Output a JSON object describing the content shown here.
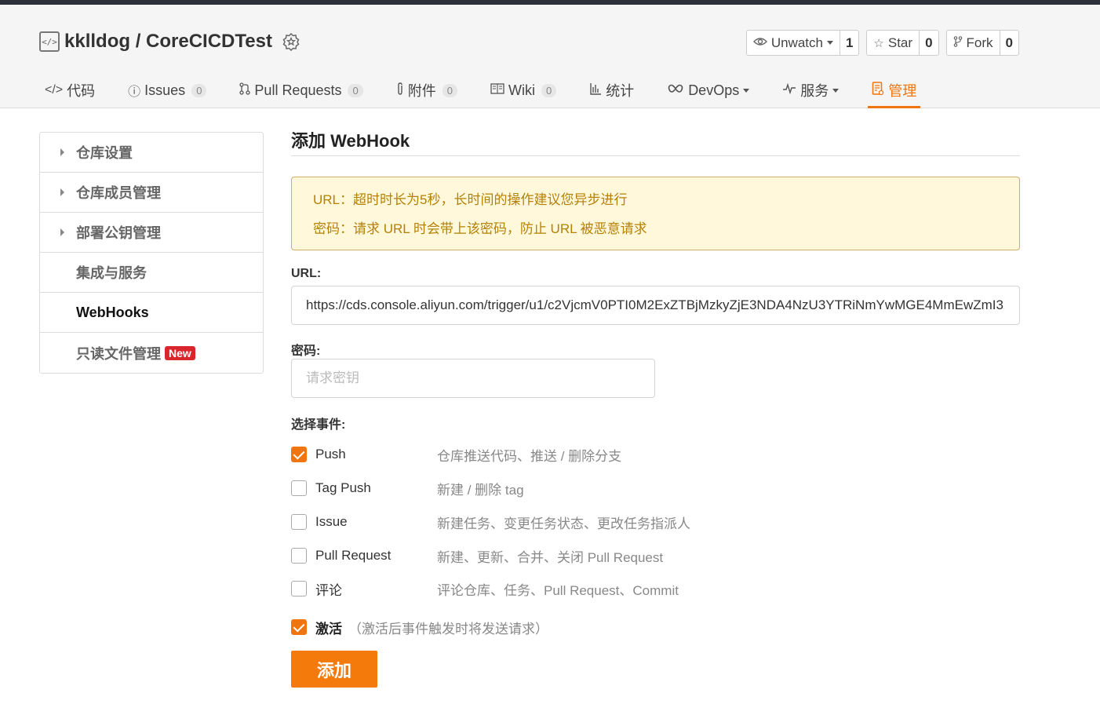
{
  "repo": {
    "owner": "kklldog",
    "separator": "/",
    "name": "CoreCICDTest"
  },
  "actions": {
    "watch": {
      "label": "Unwatch",
      "count": "1"
    },
    "star": {
      "label": "Star",
      "count": "0"
    },
    "fork": {
      "label": "Fork",
      "count": "0"
    }
  },
  "tabs": [
    {
      "label": "代码",
      "icon": "code-icon"
    },
    {
      "label": "Issues",
      "count": "0",
      "icon": "issue-icon"
    },
    {
      "label": "Pull Requests",
      "count": "0",
      "icon": "pull-request-icon"
    },
    {
      "label": "附件",
      "count": "0",
      "icon": "paperclip-icon"
    },
    {
      "label": "Wiki",
      "count": "0",
      "icon": "book-icon"
    },
    {
      "label": "统计",
      "icon": "bar-chart-icon"
    },
    {
      "label": "DevOps",
      "icon": "infinity-icon"
    },
    {
      "label": "服务",
      "icon": "pulse-icon"
    },
    {
      "label": "管理",
      "icon": "settings-doc-icon"
    }
  ],
  "sidebar": {
    "items": [
      {
        "label": "仓库设置"
      },
      {
        "label": "仓库成员管理"
      },
      {
        "label": "部署公钥管理"
      },
      {
        "label": "集成与服务"
      },
      {
        "label": "WebHooks"
      },
      {
        "label": "只读文件管理",
        "badge": "New"
      }
    ]
  },
  "main": {
    "title": "添加 WebHook",
    "notice": {
      "line1": "URL：超时时长为5秒，长时间的操作建议您异步进行",
      "line2": "密码：请求 URL 时会带上该密码，防止 URL 被恶意请求"
    },
    "url_label": "URL:",
    "url_value": "https://cds.console.aliyun.com/trigger/u1/c2VjcmV0PTI0M2ExZTBjMzkyZjE3NDA4NzU3YTRiNmYwMGE4MmEwZmI3",
    "password_label": "密码:",
    "password_placeholder": "请求密钥",
    "events_label": "选择事件:",
    "events": [
      {
        "name": "Push",
        "desc": "仓库推送代码、推送 / 删除分支",
        "checked": true
      },
      {
        "name": "Tag Push",
        "desc": "新建 / 删除 tag",
        "checked": false
      },
      {
        "name": "Issue",
        "desc": "新建任务、变更任务状态、更改任务指派人",
        "checked": false
      },
      {
        "name": "Pull Request",
        "desc": "新建、更新、合并、关闭 Pull Request",
        "checked": false
      },
      {
        "name": "评论",
        "desc": "评论仓库、任务、Pull Request、Commit",
        "checked": false
      }
    ],
    "activate_label": "激活",
    "activate_hint": "（激活后事件触发时将发送请求）",
    "submit_label": "添加"
  },
  "colors": {
    "accent": "#f0750e",
    "warning_bg": "#fff8db",
    "warning_text": "#b58105",
    "badge_new": "#d9262c"
  }
}
